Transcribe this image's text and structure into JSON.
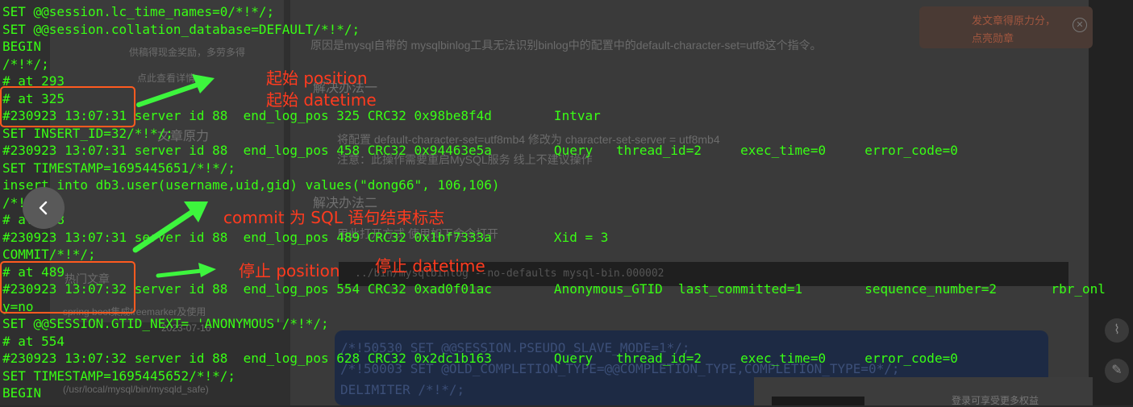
{
  "background_page": {
    "left_card": {
      "reward_text": "供稿得现金奖励，多劳多得",
      "view_link": "点此查看详情",
      "promo_text": "文章原力",
      "hot_title": "热门文章",
      "hot_item_1": "spring boot集成freemarker及使用",
      "hot_item_1_meta": "2023-07-16"
    },
    "article_text_1": "原因是mysql自带的 mysqlbinlog工具无法识别binlog中的配置中的default-character-set=utf8这个指令。",
    "heading_1": "解决办法一",
    "text_2": "将配置 default-character-set=utf8mb4 修改为 character-set-server = utf8mb4",
    "text_3": "注意：此操作需要重启MySQL服务 线上不建议操作",
    "heading_2": "解决办法二",
    "text_4": "用此打开方式 使用如下命令打开",
    "code_snip": "../bin/mysqlbinlog --no-defaults mysql-bin.000002",
    "code_block_1": "/*!50530 SET @@SESSION.PSEUDO_SLAVE_MODE=1*/;",
    "code_block_2": "/*!50003 SET @OLD_COMPLETION_TYPE=@@COMPLETION_TYPE,COMPLETION_TYPE=0*/;",
    "code_block_3": "DELIMITER /*!*/;",
    "safe_path": "(/usr/local/mysql/bin/mysqld_safe)",
    "banner_line_1": "发文章得原力分，",
    "banner_line_2": "点亮勋章",
    "footer_text": "登录可享受更多权益"
  },
  "terminal_lines": [
    "SET @@session.lc_time_names=0/*!*/;",
    "SET @@session.collation_database=DEFAULT/*!*/;",
    "BEGIN",
    "/*!*/;",
    "# at 293",
    "# at 325",
    "#230923 13:07:31 server id 88  end_log_pos 325 CRC32 0x98be8f4d        Intvar",
    "SET INSERT_ID=32/*!*/;",
    "#230923 13:07:31 server id 88  end_log_pos 458 CRC32 0x94463e5a        Query   thread_id=2     exec_time=0     error_code=0",
    "SET TIMESTAMP=1695445651/*!*/;",
    "insert into db3.user(username,uid,gid) values(\"dong66\", 106,106)",
    "/*!*/;",
    "# at 458",
    "#230923 13:07:31 server id 88  end_log_pos 489 CRC32 0x1bf7333a        Xid = 3",
    "COMMIT/*!*/;",
    "# at 489",
    "#230923 13:07:32 server id 88  end_log_pos 554 CRC32 0xad0f01ac        Anonymous_GTID  last_committed=1        sequence_number=2       rbr_onl",
    "y=no",
    "SET @@SESSION.GTID_NEXT= 'ANONYMOUS'/*!*/;",
    "# at 554",
    "#230923 13:07:32 server id 88  end_log_pos 628 CRC32 0x2dc1b163        Query   thread_id=2     exec_time=0     error_code=0",
    "SET TIMESTAMP=1695445652/*!*/;",
    "BEGIN"
  ],
  "annotations": {
    "start_position": "起始 position",
    "start_datetime": "起始 datetime",
    "commit_note": "commit 为 SQL 语句结束标志",
    "stop_position": "停止 position",
    "stop_datetime": "停止 datetime"
  },
  "colors": {
    "terminal_text": "#39ff14",
    "annotation": "#ff3b1f",
    "box": "#ff5a1f",
    "arrow": "#3df53d"
  }
}
